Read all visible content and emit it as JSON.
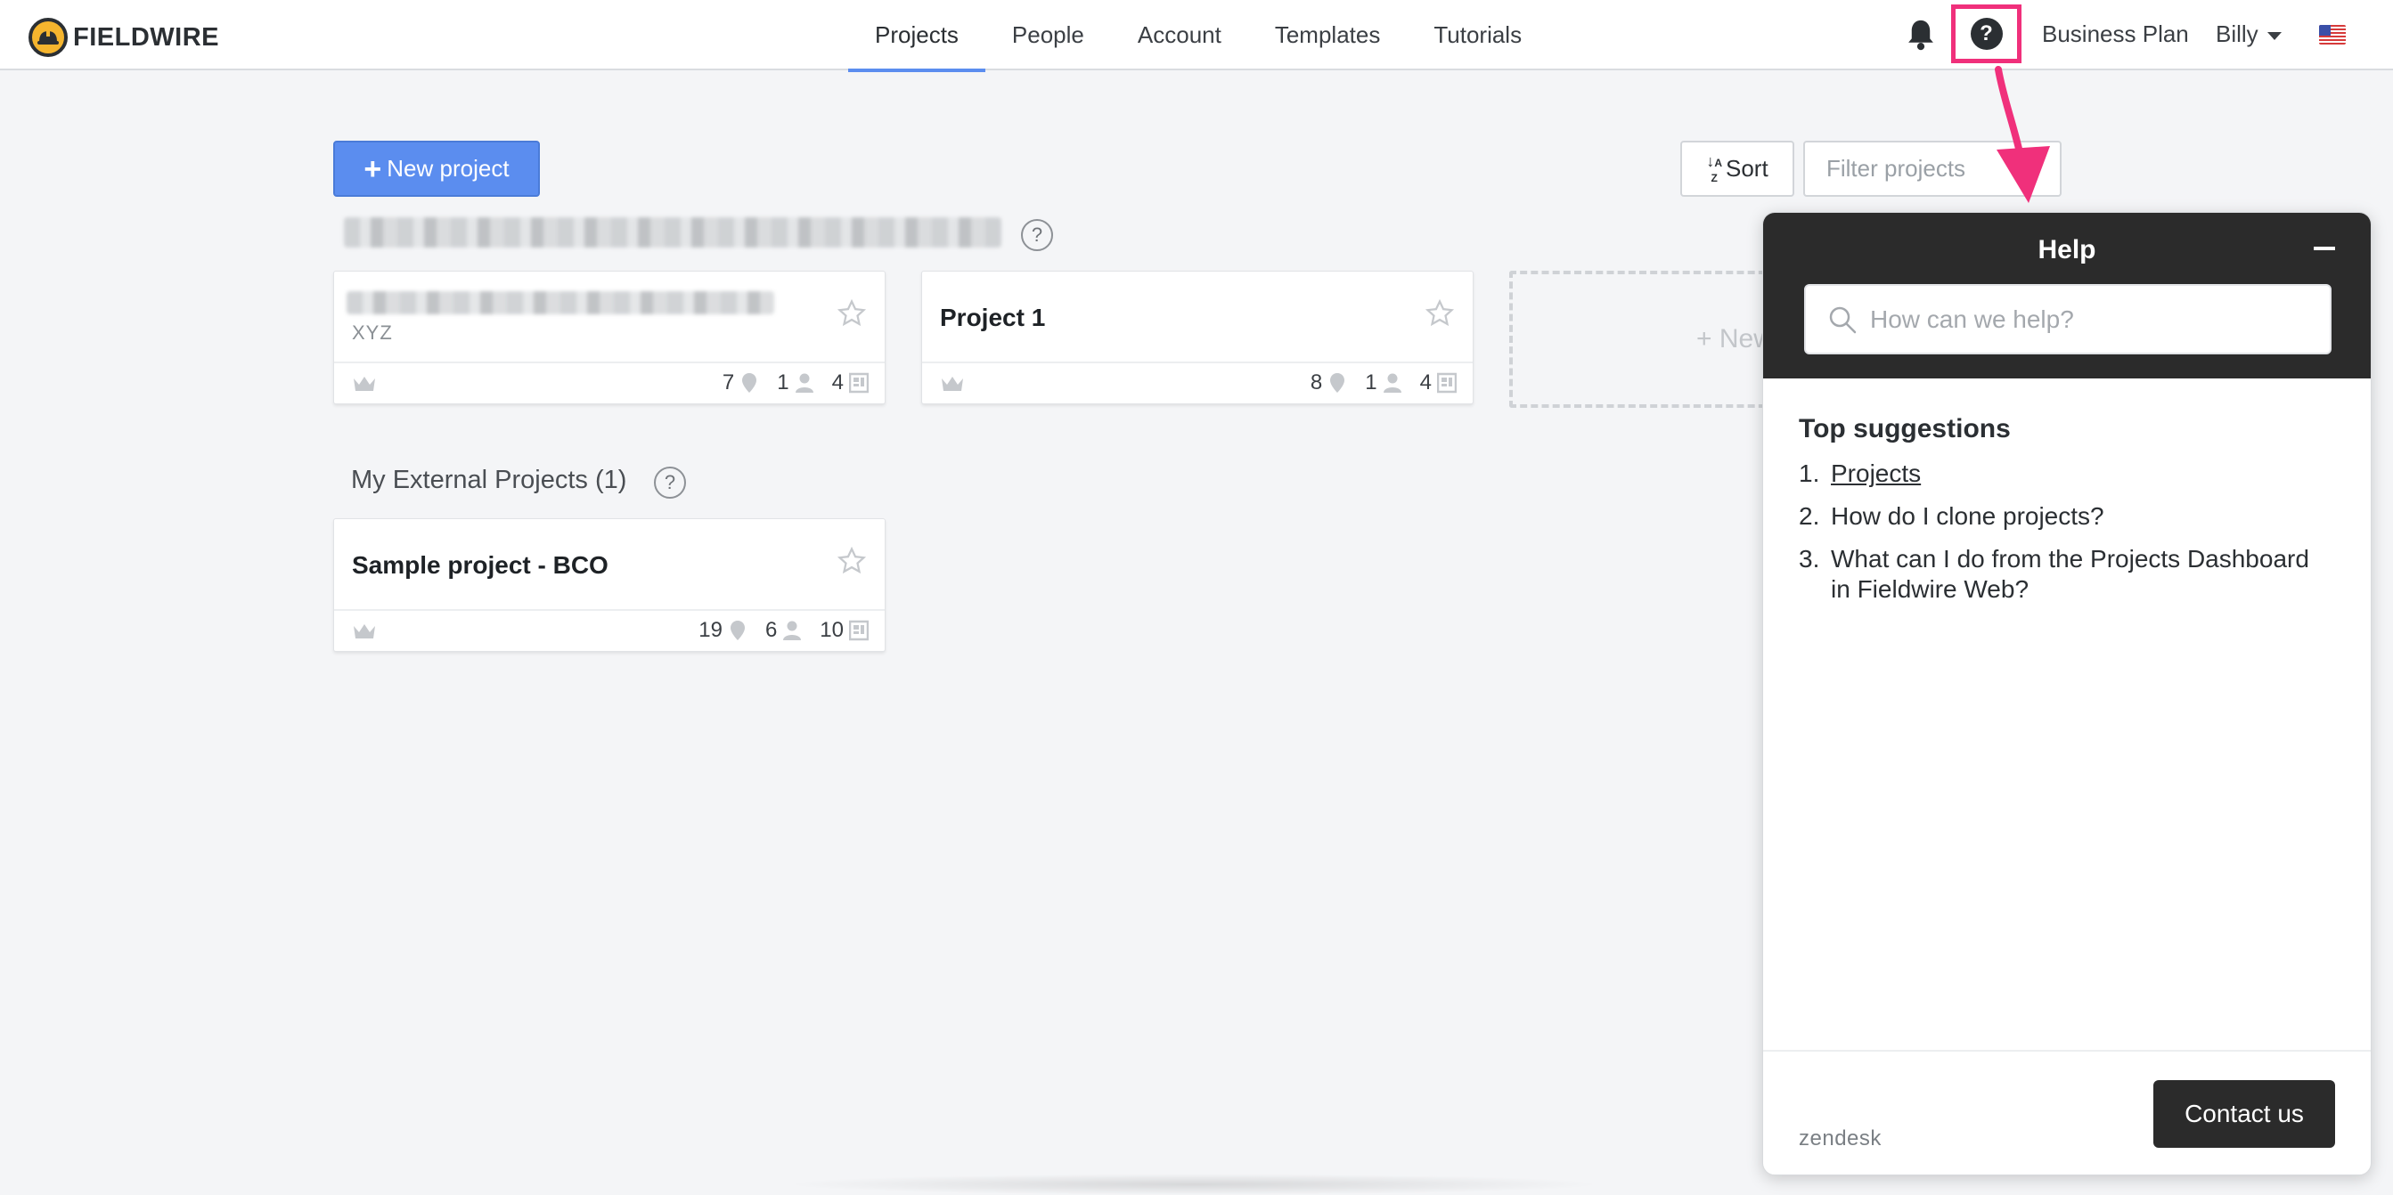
{
  "app": {
    "logo_text": "FIELDWIRE"
  },
  "nav": {
    "tabs": [
      {
        "label": "Projects",
        "active": true
      },
      {
        "label": "People"
      },
      {
        "label": "Account"
      },
      {
        "label": "Templates"
      },
      {
        "label": "Tutorials"
      }
    ],
    "plan_label": "Business Plan",
    "user_name": "Billy",
    "help_icon_glyph": "?",
    "highlight_color": "#f0307b"
  },
  "toolbar": {
    "new_project_label": "New project",
    "sort_label": "Sort",
    "filter_placeholder": "Filter projects"
  },
  "my_projects": {
    "cards": [
      {
        "title": "",
        "subtitle": "XYZ",
        "title_blurred": true,
        "stats": {
          "locations": "7",
          "people": "1",
          "plans": "4"
        }
      },
      {
        "title": "Project 1",
        "subtitle": "",
        "stats": {
          "locations": "8",
          "people": "1",
          "plans": "4"
        }
      }
    ],
    "new_card_label": "+ New"
  },
  "external_projects": {
    "title": "My External Projects (1)",
    "cards": [
      {
        "title": "Sample project - BCO",
        "stats": {
          "locations": "19",
          "people": "6",
          "plans": "10"
        }
      }
    ]
  },
  "help_widget": {
    "title": "Help",
    "search_placeholder": "How can we help?",
    "suggestions_title": "Top suggestions",
    "suggestions": [
      {
        "num": "1.",
        "text": "Projects"
      },
      {
        "num": "2.",
        "text": "How do I clone projects?"
      },
      {
        "num": "3.",
        "text": "What can I do from the Projects Dashboard in Fieldwire Web?"
      }
    ],
    "footer_brand": "zendesk",
    "contact_label": "Contact us"
  },
  "colors": {
    "accent": "#5b8def",
    "help_header": "#2b2b2b",
    "logo_yellow": "#f5b52e"
  }
}
